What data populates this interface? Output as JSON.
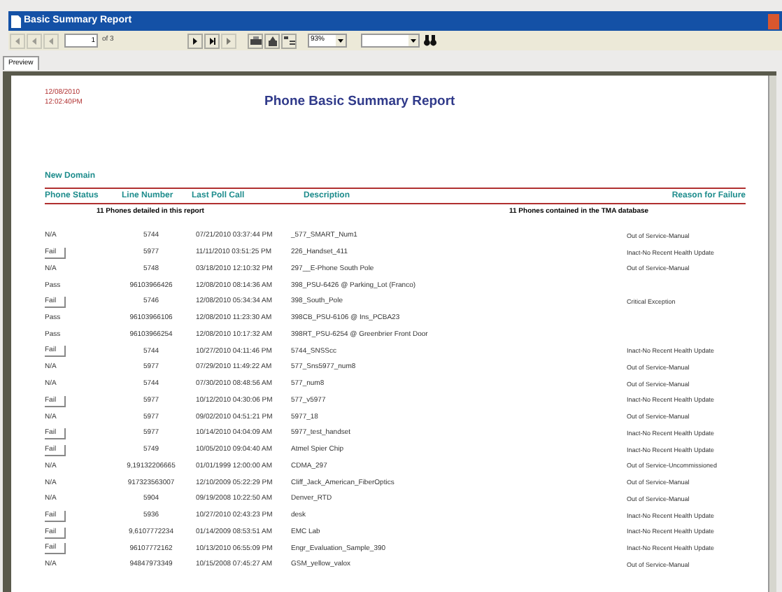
{
  "window": {
    "title": "Basic Summary Report"
  },
  "toolbar": {
    "page": "1",
    "page_count": "of 3",
    "zoom": "93%"
  },
  "tabs": [
    {
      "label": "Preview",
      "selected": true
    }
  ],
  "report": {
    "date": "12/08/2010",
    "time": "12:02:40PM",
    "title": "Phone Basic Summary Report",
    "group": "New Domain",
    "columns": [
      "Phone Status",
      "Line Number",
      "Last Poll Call",
      "Description",
      "Reason for Failure"
    ],
    "summary_left": "11  Phones detailed in this report",
    "summary_right": "11  Phones contained in the TMA database",
    "rows": [
      {
        "status": "N/A",
        "drill_down": false,
        "line": "5744",
        "last_poll": "07/21/2010 03:37:44 PM",
        "description": "_577_SMART_Num1",
        "reason": "Out of Service-Manual"
      },
      {
        "status": "Fail",
        "drill_down": true,
        "line": "5977",
        "last_poll": "11/11/2010 03:51:25 PM",
        "description": "226_Handset_411",
        "reason": "Inact-No Recent Health Update"
      },
      {
        "status": "N/A",
        "drill_down": false,
        "line": "5748",
        "last_poll": "03/18/2010 12:10:32 PM",
        "description": "297__E-Phone South Pole",
        "reason": "Out of Service-Manual"
      },
      {
        "status": "Pass",
        "drill_down": false,
        "line": "96103966426",
        "last_poll": "12/08/2010 08:14:36 AM",
        "description": "398_PSU-6426 @ Parking_Lot (Franco)",
        "reason": ""
      },
      {
        "status": "Fail",
        "drill_down": true,
        "line": "5746",
        "last_poll": "12/08/2010 05:34:34 AM",
        "description": "398_South_Pole",
        "reason": "Critical Exception"
      },
      {
        "status": "Pass",
        "drill_down": false,
        "line": "96103966106",
        "last_poll": "12/08/2010 11:23:30 AM",
        "description": "398CB_PSU-6106 @ Ins_PCBA23",
        "reason": ""
      },
      {
        "status": "Pass",
        "drill_down": false,
        "line": "96103966254",
        "last_poll": "12/08/2010 10:17:32 AM",
        "description": "398RT_PSU-6254 @ Greenbrier Front Door",
        "reason": ""
      },
      {
        "status": "Fail",
        "drill_down": true,
        "line": "5744",
        "last_poll": "10/27/2010 04:11:46 PM",
        "description": "5744_SNSScc",
        "reason": "Inact-No Recent Health Update"
      },
      {
        "status": "N/A",
        "drill_down": false,
        "line": "5977",
        "last_poll": "07/29/2010 11:49:22 AM",
        "description": "577_Sns5977_num8",
        "reason": "Out of Service-Manual"
      },
      {
        "status": "N/A",
        "drill_down": false,
        "line": "5744",
        "last_poll": "07/30/2010 08:48:56 AM",
        "description": "577_num8",
        "reason": "Out of Service-Manual"
      },
      {
        "status": "Fail",
        "drill_down": true,
        "line": "5977",
        "last_poll": "10/12/2010 04:30:06 PM",
        "description": "577_v5977",
        "reason": "Inact-No Recent Health Update"
      },
      {
        "status": "N/A",
        "drill_down": false,
        "line": "5977",
        "last_poll": "09/02/2010 04:51:21 PM",
        "description": "5977_18",
        "reason": "Out of Service-Manual"
      },
      {
        "status": "Fail",
        "drill_down": true,
        "line": "5977",
        "last_poll": "10/14/2010 04:04:09 AM",
        "description": "5977_test_handset",
        "reason": "Inact-No Recent Health Update"
      },
      {
        "status": "Fail",
        "drill_down": true,
        "line": "5749",
        "last_poll": "10/05/2010 09:04:40 AM",
        "description": "Atmel Spier Chip",
        "reason": "Inact-No Recent Health Update"
      },
      {
        "status": "N/A",
        "drill_down": false,
        "line": "9,19132206665",
        "last_poll": "01/01/1999 12:00:00 AM",
        "description": "CDMA_297",
        "reason": "Out of Service-Uncommissioned"
      },
      {
        "status": "N/A",
        "drill_down": false,
        "line": "917323563007",
        "last_poll": "12/10/2009 05:22:29 PM",
        "description": "Cliff_Jack_American_FiberOptics",
        "reason": "Out of Service-Manual"
      },
      {
        "status": "N/A",
        "drill_down": false,
        "line": "5904",
        "last_poll": "09/19/2008 10:22:50 AM",
        "description": "Denver_RTD",
        "reason": "Out of Service-Manual"
      },
      {
        "status": "Fail",
        "drill_down": true,
        "line": "5936",
        "last_poll": "10/27/2010 02:43:23 PM",
        "description": "desk",
        "reason": "Inact-No Recent Health Update"
      },
      {
        "status": "Fail",
        "drill_down": true,
        "line": "9,6107772234",
        "last_poll": "01/14/2009 08:53:51 AM",
        "description": "EMC Lab",
        "reason": "Inact-No Recent Health Update"
      },
      {
        "status": "Fail",
        "drill_down": true,
        "line": "96107772162",
        "last_poll": "10/13/2010 06:55:09 PM",
        "description": "Engr_Evaluation_Sample_390",
        "reason": "Inact-No Recent Health Update"
      },
      {
        "status": "N/A",
        "drill_down": false,
        "line": "94847973349",
        "last_poll": "10/15/2008 07:45:27 AM",
        "description": "GSM_yellow_valox",
        "reason": "Out of Service-Manual"
      }
    ]
  }
}
